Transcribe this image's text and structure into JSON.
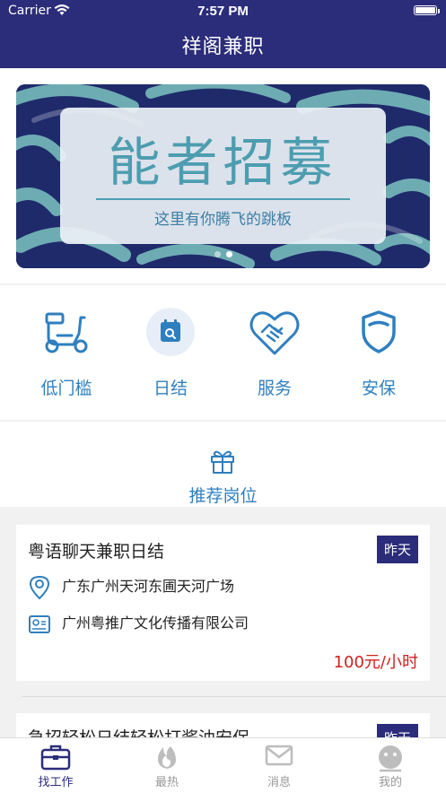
{
  "status_bar": {
    "carrier": "Carrier",
    "time": "7:57 PM"
  },
  "nav": {
    "title": "祥阁兼职"
  },
  "banner": {
    "headline": "能者招募",
    "subtitle": "这里有你腾飞的跳板"
  },
  "features": [
    {
      "label": "低门槛",
      "icon": "scooter-icon"
    },
    {
      "label": "日结",
      "icon": "calendar-search-icon"
    },
    {
      "label": "服务",
      "icon": "handshake-heart-icon"
    },
    {
      "label": "安保",
      "icon": "shield-icon"
    }
  ],
  "recommend": {
    "title": "推荐岗位",
    "icon": "gift-icon"
  },
  "jobs": [
    {
      "title": "粤语聊天兼职日结",
      "badge": "昨天",
      "location": "广东广州天河东圃天河广场",
      "company": "广州粤推广文化传播有限公司",
      "pay": "100元/小时"
    },
    {
      "title": "急招轻松日结轻松打酱油安保",
      "badge": "昨天"
    }
  ],
  "tabbar": [
    {
      "label": "找工作",
      "icon": "briefcase-icon"
    },
    {
      "label": "最热",
      "icon": "flame-icon"
    },
    {
      "label": "消息",
      "icon": "envelope-icon"
    },
    {
      "label": "我的",
      "icon": "smiley-face-icon"
    }
  ],
  "colors": {
    "primary": "#2b2c7a",
    "accent": "#2f7fbf",
    "pay": "#d0211c"
  }
}
